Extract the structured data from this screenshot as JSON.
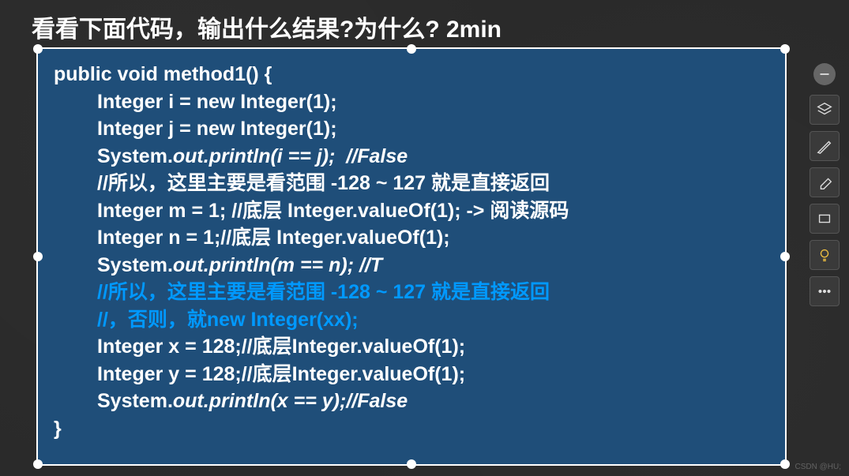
{
  "title": "看看下面代码，输出什么结果?为什么? 2min",
  "code": {
    "l1": "public void method1() {",
    "l2": "Integer i = new Integer(1);",
    "l3": "Integer j = new Integer(1);",
    "l4a": "System.",
    "l4b": "out.println(i == j);  //False",
    "l5": "//所以，这里主要是看范围 -128 ~ 127 就是直接返回",
    "l6": "Integer m = 1; //底层 Integer.valueOf(1); -> 阅读源码",
    "l7": "Integer n = 1;//底层 Integer.valueOf(1);",
    "l8a": "System.",
    "l8b": "out.println(m == n); //T",
    "l9": "//所以，这里主要是看范围 -128 ~ 127 就是直接返回",
    "l10": "//，否则，就new Integer(xx);",
    "l11": "Integer x = 128;//底层Integer.valueOf(1);",
    "l12": "Integer y = 128;//底层Integer.valueOf(1);",
    "l13a": "System.",
    "l13b": "out.println(x == y);//False",
    "l14": "}"
  },
  "toolbar": {
    "minimize": "minimize",
    "layers": "layers",
    "pen": "pen",
    "eraser": "eraser",
    "shape": "shape",
    "bulb": "bulb",
    "more": "more"
  },
  "watermark": "CSDN @HU;"
}
